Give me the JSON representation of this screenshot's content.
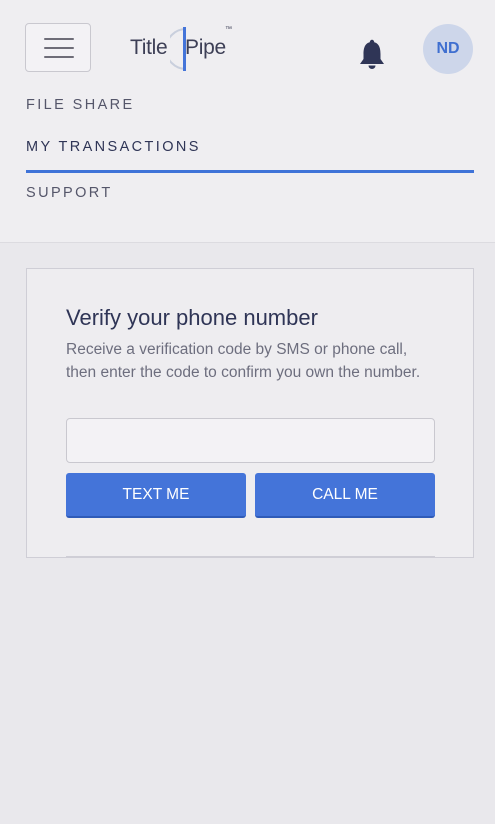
{
  "header": {
    "logo": {
      "text_left": "Title",
      "text_right": "Pipe",
      "trademark": "™"
    },
    "avatar_initials": "ND",
    "icons": [
      "menu-icon",
      "bell-icon"
    ]
  },
  "nav": {
    "items": [
      {
        "label": "FILE SHARE",
        "active": false
      },
      {
        "label": "MY TRANSACTIONS",
        "active": true
      },
      {
        "label": "SUPPORT",
        "active": false
      }
    ]
  },
  "verify": {
    "title": "Verify your phone number",
    "description": "Receive a verification code by SMS or phone call, then enter the code to confirm you own the number.",
    "phone_value": "",
    "text_button": "TEXT ME",
    "call_button": "CALL ME"
  },
  "colors": {
    "accent": "#4474d9",
    "text_dark": "#2f3556",
    "background": "#e9e8ec"
  }
}
